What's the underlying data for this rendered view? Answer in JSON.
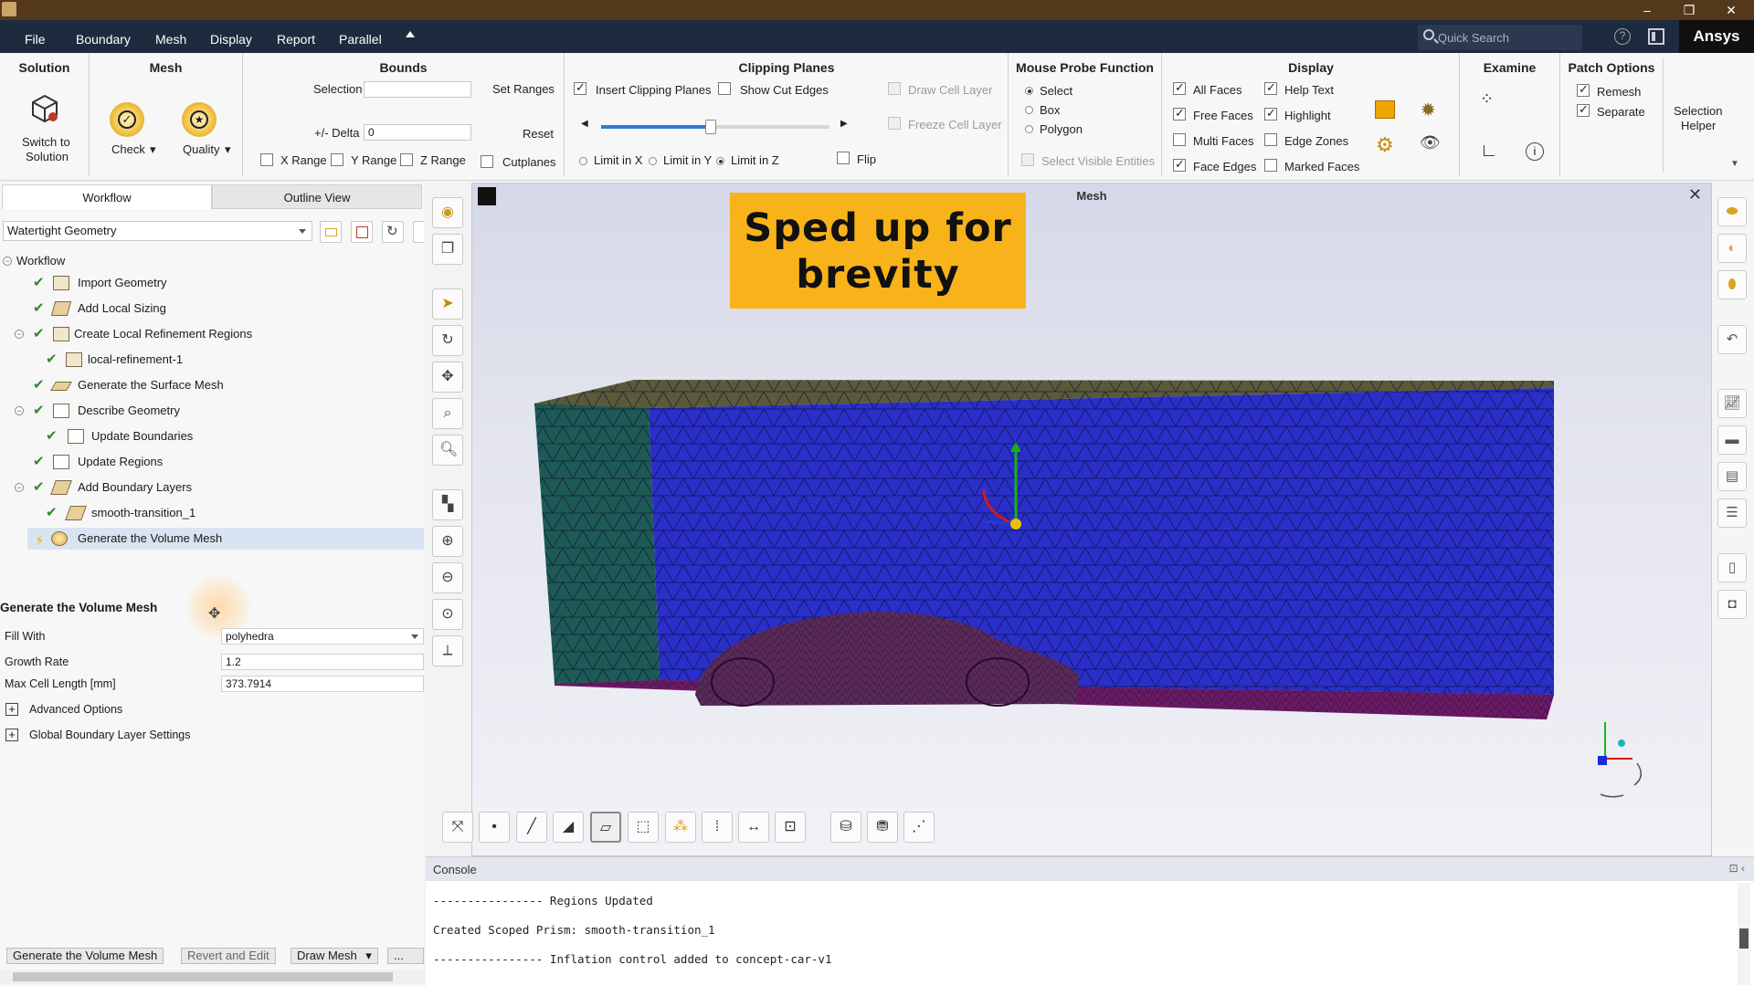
{
  "menu": {
    "items": [
      "File",
      "Boundary",
      "Mesh",
      "Display",
      "Report",
      "Parallel"
    ],
    "search_placeholder": "Quick Search",
    "brand": "Ansys"
  },
  "ribbon": {
    "solution": {
      "title": "Solution",
      "switch_label_1": "Switch to",
      "switch_label_2": "Solution"
    },
    "mesh": {
      "title": "Mesh",
      "check": "Check",
      "quality": "Quality"
    },
    "bounds": {
      "title": "Bounds",
      "selection": "Selection",
      "set_ranges": "Set Ranges",
      "delta_label": "+/- Delta",
      "delta_value": "0",
      "reset": "Reset",
      "x_range": "X Range",
      "y_range": "Y Range",
      "z_range": "Z Range",
      "cutplanes": "Cutplanes"
    },
    "clipping": {
      "title": "Clipping Planes",
      "insert": "Insert Clipping Planes",
      "show_cut": "Show Cut Edges",
      "draw_cell_layer": "Draw Cell Layer",
      "freeze_cell_layer": "Freeze Cell Layer",
      "limit_x": "Limit in X",
      "limit_y": "Limit in Y",
      "limit_z": "Limit in Z",
      "flip": "Flip",
      "slider_value": 0.48
    },
    "probe": {
      "title": "Mouse Probe Function",
      "select": "Select",
      "box": "Box",
      "polygon": "Polygon",
      "select_visible": "Select Visible Entities"
    },
    "display": {
      "title": "Display",
      "all_faces": "All Faces",
      "free_faces": "Free Faces",
      "multi_faces": "Multi Faces",
      "face_edges": "Face Edges",
      "help_text": "Help Text",
      "highlight": "Highlight",
      "edge_zones": "Edge Zones",
      "marked_faces": "Marked Faces"
    },
    "examine": {
      "title": "Examine"
    },
    "patch": {
      "title": "Patch Options",
      "remesh": "Remesh",
      "separate": "Separate",
      "selection_helper_1": "Selection",
      "selection_helper_2": "Helper"
    }
  },
  "left": {
    "tabs": [
      "Workflow",
      "Outline View"
    ],
    "workflow_type": "Watertight Geometry",
    "tree": [
      "Workflow",
      "Import Geometry",
      "Add Local Sizing",
      "Create Local Refinement Regions",
      "local-refinement-1",
      "Generate the Surface Mesh",
      "Describe Geometry",
      "Update Boundaries",
      "Update Regions",
      "Add Boundary Layers",
      "smooth-transition_1",
      "Generate the Volume Mesh"
    ],
    "props": {
      "title": "Generate the Volume Mesh",
      "fill_with_label": "Fill With",
      "fill_with_value": "polyhedra",
      "growth_rate_label": "Growth Rate",
      "growth_rate_value": "1.2",
      "max_cell_label": "Max Cell Length [mm]",
      "max_cell_value": "373.7914",
      "advanced": "Advanced Options",
      "global_bl": "Global Boundary Layer Settings"
    },
    "buttons": [
      "Generate the Volume Mesh",
      "Revert and Edit",
      "Draw Mesh",
      "..."
    ]
  },
  "viewport": {
    "title": "Mesh",
    "close": "✕",
    "banner_line1": "Sped up for",
    "banner_line2": "brevity",
    "colors": {
      "side_wall": "#1e5a55",
      "back_wall": "#2a2fc8",
      "floor": "#6a1a66",
      "top": "#5a5a3a",
      "car": "#5a2a5a"
    }
  },
  "console": {
    "title": "Console",
    "lines": [
      "---------------- Regions Updated",
      "Created Scoped Prism: smooth-transition_1",
      "---------------- Inflation control added to concept-car-v1"
    ]
  }
}
